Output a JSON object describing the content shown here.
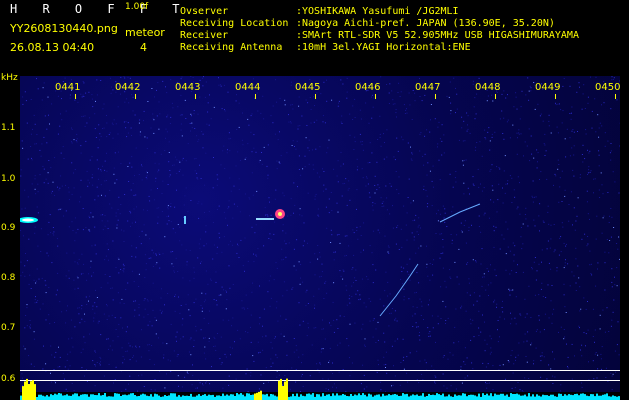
{
  "header": {
    "app_title": "H R O F F T",
    "app_version": "1.00f",
    "file_name": "YY2608130440.png",
    "date_time": "26.08.13 04:40",
    "meteor_label": "meteor",
    "meteor_count": "4",
    "info": [
      {
        "label": "Ovserver",
        "value": ":YOSHIKAWA Yasufumi /JG2MLI"
      },
      {
        "label": "Receiving Location",
        "value": ":Nagoya Aichi-pref. JAPAN (136.90E, 35.20N)"
      },
      {
        "label": "Receiver",
        "value": ":SMArt RTL-SDR V5 52.905MHz USB HIGASHIMURAYAMA"
      },
      {
        "label": "Receiving Antenna",
        "value": ":10mH 3el.YAGI Horizontal:ENE"
      }
    ]
  },
  "axis": {
    "unit": "kHz",
    "y_ticks": [
      "1.1",
      "1.0",
      "0.9",
      "0.8",
      "0.7",
      "0.6"
    ],
    "x_ticks": [
      "0441",
      "0442",
      "0443",
      "0444",
      "0445",
      "0446",
      "0447",
      "0448",
      "0449",
      "0450"
    ]
  },
  "colors": {
    "label": "#ffff00",
    "text": "#ffffff",
    "background": "#000000",
    "spectrogram_bg": "#050550",
    "signal": "#ffffff",
    "level": "#00ffff"
  }
}
